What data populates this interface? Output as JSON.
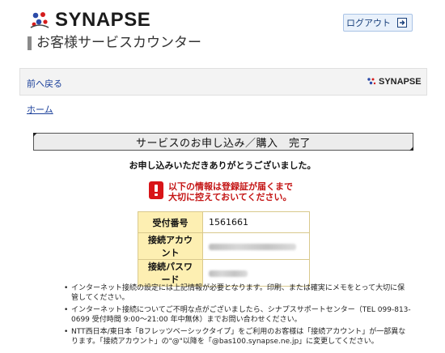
{
  "header": {
    "brand": "SYNAPSE",
    "subtitle": "お客様サービスカウンター",
    "logout_label": "ログアウト"
  },
  "nav": {
    "back_label": "前へ戻る",
    "brand_small": "SYNAPSE"
  },
  "breadcrumb": {
    "home_label": "ホーム"
  },
  "main": {
    "title": "サービスのお申し込み／購入　完了",
    "thanks": "お申し込みいただきありがとうございました。",
    "notice_line1": "以下の情報は登録証が届くまで",
    "notice_line2": "大切に控えておいてください。",
    "table": [
      {
        "label": "受付番号",
        "value": "1561661"
      },
      {
        "label": "接続アカウント",
        "value": ""
      },
      {
        "label": "接続パスワード",
        "value": ""
      }
    ],
    "bullets": [
      "インターネット接続の設定には上記情報が必要となります。印刷、または確実にメモをとって大切に保管してください。",
      "インターネット接続についてご不明な点がございましたら、シナプスサポートセンター（TEL 099-813-0699 受付時間 9:00～21:00 年中無休）までお問い合わせください。",
      "NTT西日本/東日本「Bフレッツベーシックタイプ」をご利用のお客様は「接続アカウント」が一部異なります。「接続アカウント」の\"@\"以降を「@bas100.synapse.ne.jp」に変更してください。"
    ]
  },
  "colors": {
    "notice_red": "#c41414",
    "link_blue": "#1a3f9a",
    "table_label_bg": "#fdefb2"
  }
}
